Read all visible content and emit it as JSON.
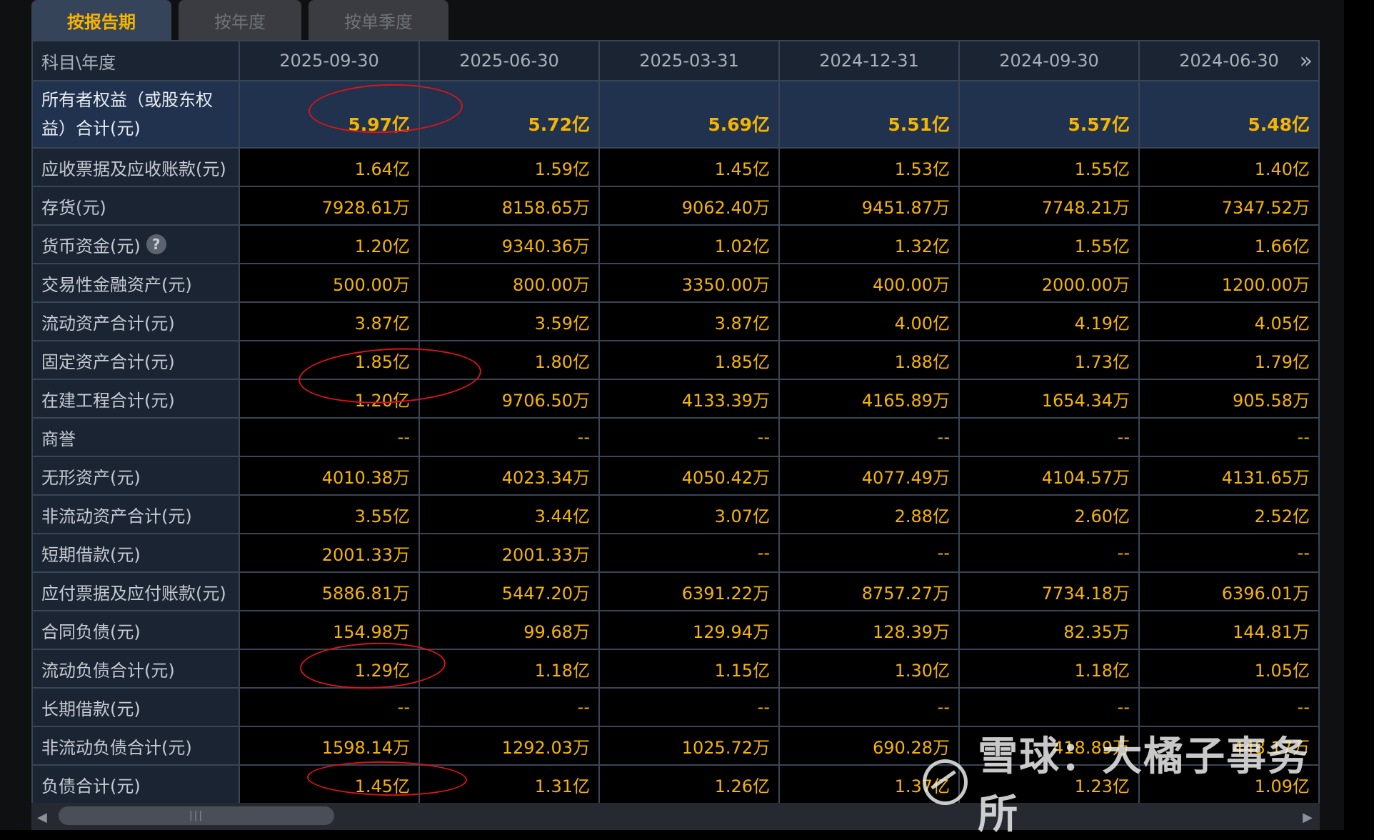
{
  "tabs": [
    {
      "label": "按报告期",
      "active": true
    },
    {
      "label": "按年度",
      "active": false
    },
    {
      "label": "按单季度",
      "active": false
    }
  ],
  "header": {
    "corner": "科目\\年度",
    "dates": [
      "2025-09-30",
      "2025-06-30",
      "2025-03-31",
      "2024-12-31",
      "2024-09-30",
      "2024-06-30"
    ]
  },
  "rows": [
    {
      "label": "所有者权益（或股东权益）合计(元)",
      "values": [
        "5.97亿",
        "5.72亿",
        "5.69亿",
        "5.51亿",
        "5.57亿",
        "5.48亿"
      ]
    },
    {
      "label": "应收票据及应收账款(元)",
      "values": [
        "1.64亿",
        "1.59亿",
        "1.45亿",
        "1.53亿",
        "1.55亿",
        "1.40亿"
      ]
    },
    {
      "label": "存货(元)",
      "values": [
        "7928.61万",
        "8158.65万",
        "9062.40万",
        "9451.87万",
        "7748.21万",
        "7347.52万"
      ]
    },
    {
      "label": "货币资金(元)",
      "values": [
        "1.20亿",
        "9340.36万",
        "1.02亿",
        "1.32亿",
        "1.55亿",
        "1.66亿"
      ]
    },
    {
      "label": "交易性金融资产(元)",
      "values": [
        "500.00万",
        "800.00万",
        "3350.00万",
        "400.00万",
        "2000.00万",
        "1200.00万"
      ]
    },
    {
      "label": "流动资产合计(元)",
      "values": [
        "3.87亿",
        "3.59亿",
        "3.87亿",
        "4.00亿",
        "4.19亿",
        "4.05亿"
      ]
    },
    {
      "label": "固定资产合计(元)",
      "values": [
        "1.85亿",
        "1.80亿",
        "1.85亿",
        "1.88亿",
        "1.73亿",
        "1.79亿"
      ]
    },
    {
      "label": "在建工程合计(元)",
      "values": [
        "1.20亿",
        "9706.50万",
        "4133.39万",
        "4165.89万",
        "1654.34万",
        "905.58万"
      ]
    },
    {
      "label": "商誉",
      "values": [
        "--",
        "--",
        "--",
        "--",
        "--",
        "--"
      ]
    },
    {
      "label": "无形资产(元)",
      "values": [
        "4010.38万",
        "4023.34万",
        "4050.42万",
        "4077.49万",
        "4104.57万",
        "4131.65万"
      ]
    },
    {
      "label": "非流动资产合计(元)",
      "values": [
        "3.55亿",
        "3.44亿",
        "3.07亿",
        "2.88亿",
        "2.60亿",
        "2.52亿"
      ]
    },
    {
      "label": "短期借款(元)",
      "values": [
        "2001.33万",
        "2001.33万",
        "--",
        "--",
        "--",
        "--"
      ]
    },
    {
      "label": "应付票据及应付账款(元)",
      "values": [
        "5886.81万",
        "5447.20万",
        "6391.22万",
        "8757.27万",
        "7734.18万",
        "6396.01万"
      ]
    },
    {
      "label": "合同负债(元)",
      "values": [
        "154.98万",
        "99.68万",
        "129.94万",
        "128.39万",
        "82.35万",
        "144.81万"
      ]
    },
    {
      "label": "流动负债合计(元)",
      "values": [
        "1.29亿",
        "1.18亿",
        "1.15亿",
        "1.30亿",
        "1.18亿",
        "1.05亿"
      ]
    },
    {
      "label": "长期借款(元)",
      "values": [
        "--",
        "--",
        "--",
        "--",
        "--",
        "--"
      ]
    },
    {
      "label": "非流动负债合计(元)",
      "values": [
        "1598.14万",
        "1292.03万",
        "1025.72万",
        "690.28万",
        "418.89万",
        "448.17万"
      ]
    },
    {
      "label": "负债合计(元)",
      "values": [
        "1.45亿",
        "1.31亿",
        "1.26亿",
        "1.37亿",
        "1.23亿",
        "1.09亿"
      ]
    }
  ],
  "help_icon_text": "?",
  "scroll_grip": "|||",
  "watermark": "雪球：大橘子事务所",
  "colors": {
    "value": "#f5b400",
    "label": "#c6cad2",
    "annotation": "#d9141a",
    "header_bg": "#1b2433"
  }
}
